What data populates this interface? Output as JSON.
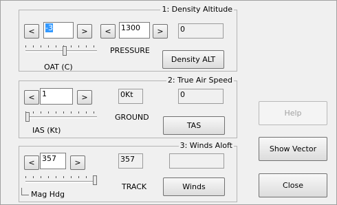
{
  "group1": {
    "title": "1: Density Altitude",
    "oat_value": "-3",
    "pressure_value": "1300",
    "result_value": "0",
    "pressure_label": "PRESSURE",
    "oat_label": "OAT (C)",
    "button_label": "Density ALT",
    "oat_slider_level": 0.55
  },
  "group2": {
    "title": "2: True Air Speed",
    "ias_value": "1",
    "ground_value": "0Kt",
    "result_value": "0",
    "ground_label": "GROUND",
    "ias_label": "IAS (Kt)",
    "button_label": "TAS",
    "ias_slider_level": 0.0
  },
  "group3": {
    "title": "3: Winds Aloft",
    "hdg_value": "357",
    "track_value": "357",
    "result_value": "",
    "track_label": "TRACK",
    "hdg_label": "Mag Hdg",
    "button_label": "Winds",
    "hdg_slider_level": 1.0
  },
  "arrows": {
    "left": "<",
    "right": ">"
  },
  "side_buttons": {
    "help": "Help",
    "show_vector": "Show Vector",
    "close": "Close"
  }
}
